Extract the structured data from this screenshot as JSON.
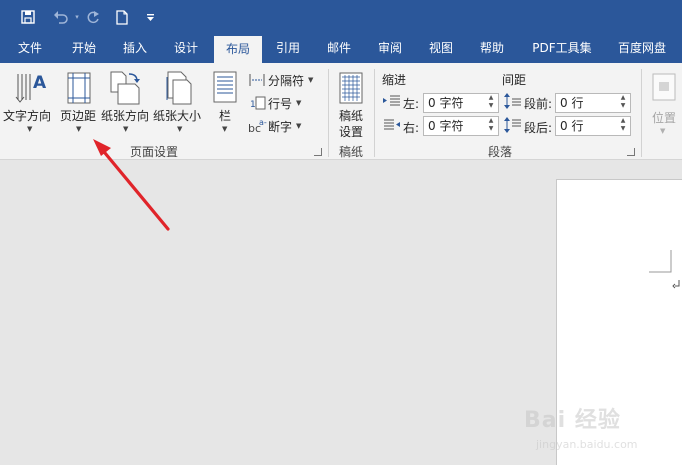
{
  "qat": {
    "save_icon": "save-icon",
    "undo_icon": "undo-icon",
    "redo_icon": "redo-icon",
    "new_icon": "new-document-icon",
    "customize_icon": "customize-qat-icon"
  },
  "tabs": [
    "文件",
    "开始",
    "插入",
    "设计",
    "布局",
    "引用",
    "邮件",
    "审阅",
    "视图",
    "帮助",
    "PDF工具集",
    "百度网盘"
  ],
  "active_tab": "布局",
  "ribbon": {
    "page_setup": {
      "text_direction": "文字方向",
      "margins": "页边距",
      "orientation": "纸张方向",
      "size": "纸张大小",
      "columns": "栏",
      "breaks": "分隔符",
      "line_numbers": "行号",
      "hyphenation": "断字",
      "group_label": "页面设置"
    },
    "manuscript": {
      "button_line1": "稿纸",
      "button_line2": "设置",
      "group_label": "稿纸"
    },
    "paragraph": {
      "indent_header": "缩进",
      "spacing_header": "间距",
      "left_label": "左:",
      "right_label": "右:",
      "before_label": "段前:",
      "after_label": "段后:",
      "left_value": "0 字符",
      "right_value": "0 字符",
      "before_value": "0 行",
      "after_value": "0 行",
      "group_label": "段落"
    },
    "arrange": {
      "position": "位置"
    }
  },
  "colors": {
    "title_bar": "#2b579a",
    "ribbon_bg": "#f3f3f3",
    "doc_bg": "#e6e6e6",
    "annotation_arrow": "#e0242a"
  },
  "watermark": {
    "brand": "Bai 经验",
    "url": "jingyan.baidu.com"
  }
}
